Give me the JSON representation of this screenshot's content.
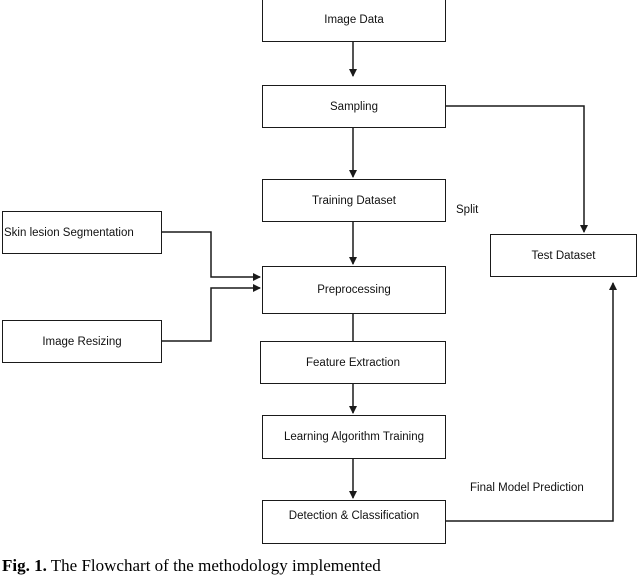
{
  "diagram": {
    "type": "flowchart",
    "nodes": {
      "image_data": "Image Data",
      "sampling": "Sampling",
      "training_dataset": "Training Dataset",
      "preprocessing": "Preprocessing",
      "feature_extraction": "Feature Extraction",
      "learning_training": "Learning Algorithm Training",
      "detection_classification": "Detection & Classification",
      "skin_lesion_segmentation": "Skin lesion Segmentation",
      "image_resizing": "Image Resizing",
      "test_dataset": "Test Dataset"
    },
    "edge_labels": {
      "split": "Split",
      "final_prediction": "Final Model Prediction"
    },
    "edges": [
      {
        "from": "image_data",
        "to": "sampling"
      },
      {
        "from": "sampling",
        "to": "training_dataset"
      },
      {
        "from": "sampling",
        "to": "test_dataset",
        "label": "Split"
      },
      {
        "from": "training_dataset",
        "to": "preprocessing"
      },
      {
        "from": "skin_lesion_segmentation",
        "to": "preprocessing"
      },
      {
        "from": "image_resizing",
        "to": "preprocessing"
      },
      {
        "from": "preprocessing",
        "to": "feature_extraction"
      },
      {
        "from": "feature_extraction",
        "to": "learning_training"
      },
      {
        "from": "learning_training",
        "to": "detection_classification"
      },
      {
        "from": "detection_classification",
        "to": "test_dataset",
        "label": "Final Model Prediction"
      }
    ],
    "line_color": "#1a1a1a"
  },
  "caption": {
    "prefix": "Fig. 1.",
    "text": " The Flowchart of the methodology implemented"
  }
}
